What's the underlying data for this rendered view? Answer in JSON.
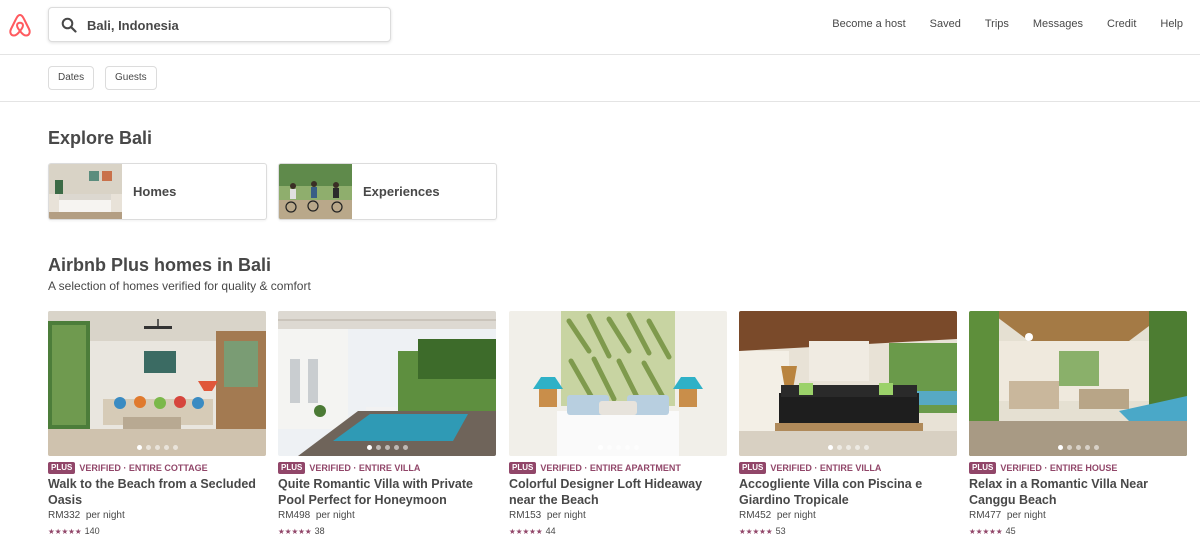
{
  "header": {
    "search_value": "Bali, Indonesia",
    "nav": [
      "Become a host",
      "Saved",
      "Trips",
      "Messages",
      "Credit",
      "Help"
    ]
  },
  "filters": {
    "dates": "Dates",
    "guests": "Guests"
  },
  "explore": {
    "title": "Explore Bali",
    "categories": [
      {
        "label": "Homes"
      },
      {
        "label": "Experiences"
      }
    ]
  },
  "plus": {
    "title": "Airbnb Plus homes in Bali",
    "subtitle": "A selection of homes verified for quality & comfort",
    "badge": "PLUS",
    "listings": [
      {
        "type": "VERIFIED · ENTIRE COTTAGE",
        "title": "Walk to the Beach from a Secluded Oasis",
        "price": "RM332",
        "per": "per night",
        "stars": "★★★★★",
        "reviews": "140"
      },
      {
        "type": "VERIFIED · ENTIRE VILLA",
        "title": "Quite Romantic Villa with Private Pool Perfect for Honeymoon",
        "price": "RM498",
        "per": "per night",
        "stars": "★★★★★",
        "reviews": "38"
      },
      {
        "type": "VERIFIED · ENTIRE APARTMENT",
        "title": "Colorful Designer Loft Hideaway near the Beach",
        "price": "RM153",
        "per": "per night",
        "stars": "★★★★★",
        "reviews": "44"
      },
      {
        "type": "VERIFIED · ENTIRE VILLA",
        "title": "Accogliente Villa con Piscina e Giardino Tropicale",
        "price": "RM452",
        "per": "per night",
        "stars": "★★★★★",
        "reviews": "53"
      },
      {
        "type": "VERIFIED · ENTIRE HOUSE",
        "title": "Relax in a Romantic Villa Near Canggu Beach",
        "price": "RM477",
        "per": "per night",
        "stars": "★★★★★",
        "reviews": "45"
      }
    ]
  },
  "colors": {
    "brand": "#FF5A5F",
    "plus": "#914669",
    "text": "#484848"
  }
}
